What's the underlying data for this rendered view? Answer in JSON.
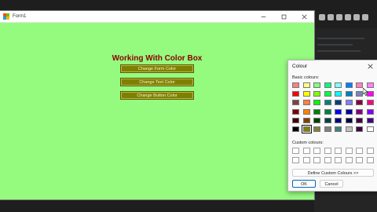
{
  "form": {
    "title": "Form1",
    "heading": "Working With Color Box",
    "background": "#95fb7f",
    "buttons": [
      {
        "label": "Change Form Color"
      },
      {
        "label": "Change Text Color"
      },
      {
        "label": "Change Button Color"
      }
    ],
    "window_controls": [
      "minimize-icon",
      "maximize-icon",
      "close-icon"
    ]
  },
  "color_dialog": {
    "title": "Colour",
    "basic_label": "Basic colours:",
    "custom_label": "Custom colours:",
    "define_label": "Define Custom Colours >>",
    "ok_label": "OK",
    "cancel_label": "Cancel",
    "basic_colors": [
      "#ff8080",
      "#ffff80",
      "#80ff80",
      "#00ff80",
      "#80ffff",
      "#0080ff",
      "#ff80c0",
      "#ff80ff",
      "#ff0000",
      "#ffff00",
      "#80ff00",
      "#00ff40",
      "#00ffff",
      "#0080c0",
      "#8080c0",
      "#ff00ff",
      "#804040",
      "#ff8040",
      "#00ff00",
      "#008080",
      "#004080",
      "#8080ff",
      "#800040",
      "#ff0080",
      "#800000",
      "#ff8000",
      "#008000",
      "#008040",
      "#0000ff",
      "#0000a0",
      "#800080",
      "#8000ff",
      "#400000",
      "#804000",
      "#004000",
      "#004040",
      "#000080",
      "#000040",
      "#400040",
      "#400080",
      "#000000",
      "#808000",
      "#808040",
      "#808080",
      "#408080",
      "#c0c0c0",
      "#400040",
      "#ffffff"
    ],
    "selected_index": 41,
    "custom_colors": [
      "#ffffff",
      "#ffffff",
      "#ffffff",
      "#ffffff",
      "#ffffff",
      "#ffffff",
      "#ffffff",
      "#ffffff",
      "#ffffff",
      "#ffffff",
      "#ffffff",
      "#ffffff",
      "#ffffff",
      "#ffffff",
      "#ffffff",
      "#ffffff"
    ]
  }
}
